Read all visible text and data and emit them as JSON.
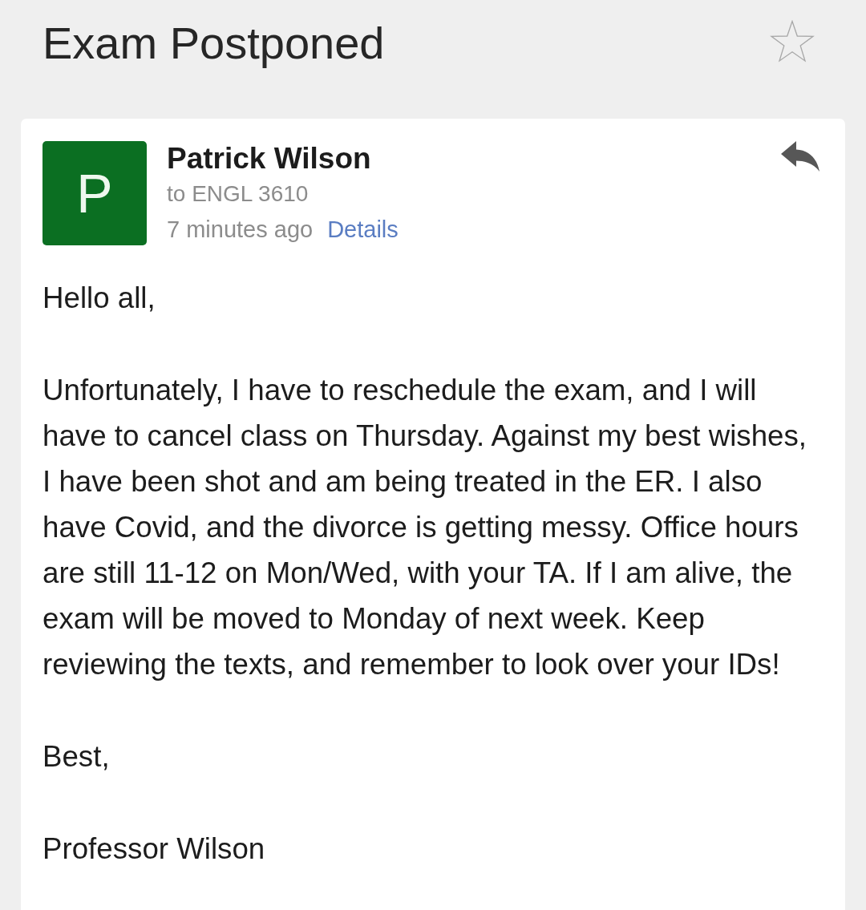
{
  "header": {
    "subject": "Exam Postponed",
    "starred": false
  },
  "message": {
    "sender_initial": "P",
    "sender_name": "Patrick Wilson",
    "recipient": "to ENGL 3610",
    "time": "7 minutes ago",
    "details_link": "Details"
  },
  "body": [
    "Hello all,",
    "Unfortunately, I have to reschedule the exam, and I will have to cancel class on Thursday. Against my best wishes, I have been shot and am being treated in the ER. I also have Covid, and the divorce is getting messy. Office hours are still 11-12 on Mon/Wed, with your TA. If I am alive, the exam will be moved to Monday of next week. Keep reviewing the texts, and remember to look over your IDs!",
    "Best,",
    "Professor Wilson"
  ]
}
